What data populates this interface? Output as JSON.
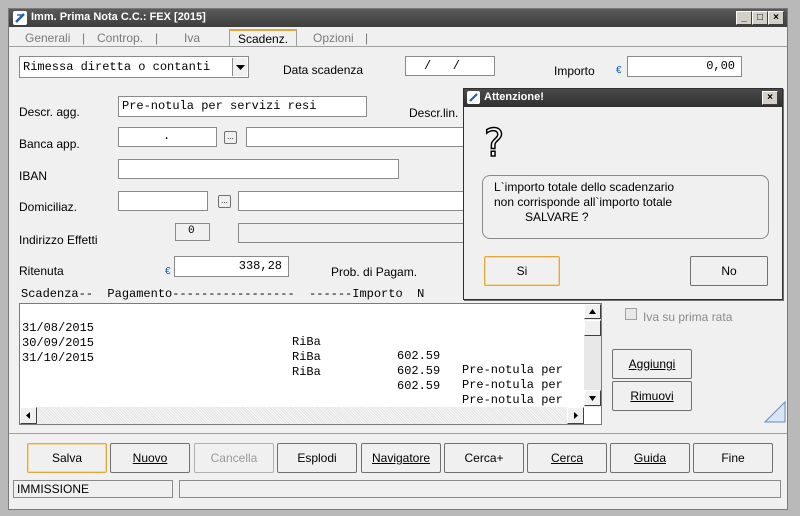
{
  "window": {
    "title": "Imm. Prima Nota C.C.: FEX [2015]",
    "minimize": "_",
    "maximize": "□",
    "close": "×"
  },
  "tabs": [
    {
      "label": "Generali"
    },
    {
      "label": "Controp."
    },
    {
      "label": "Iva"
    },
    {
      "label": "Scadenz.",
      "active": true
    },
    {
      "label": "Opzioni"
    }
  ],
  "tab_separator": "|",
  "form": {
    "payment_type": "Rimessa diretta o contanti",
    "data_scadenza_label": "Data scadenza",
    "data_scadenza_value": "/   /",
    "importo_label": "Importo",
    "currency_symbol": "€",
    "importo_value": "0,00",
    "descr_agg_label": "Descr. agg.",
    "descr_agg_value": "Pre-notula per servizi resi",
    "descr_lin_label": "Descr.lin.",
    "banca_label": "Banca app.",
    "banca_value": ".",
    "iban_label": "IBAN",
    "domiciliaz_label": "Domiciliaz.",
    "indirizzo_label": "Indirizzo Effetti",
    "indirizzo_value": "0",
    "ritenuta_label": "Ritenuta",
    "ritenuta_value": "338,28",
    "prob_label": "Prob. di Pagam.",
    "lookup_button": "..."
  },
  "grid": {
    "header": "Scadenza--  Pagamento-----------------  ------Importo  N",
    "rows": [
      {
        "scadenza": "31/08/2015",
        "pagamento": "RiBa",
        "importo": "602.59",
        "note": "Pre-notula per"
      },
      {
        "scadenza": "30/09/2015",
        "pagamento": "RiBa",
        "importo": "602.59",
        "note": "Pre-notula per"
      },
      {
        "scadenza": "31/10/2015",
        "pagamento": "RiBa",
        "importo": "602.59",
        "note": "Pre-notula per"
      }
    ]
  },
  "side": {
    "iva_checkbox_label": "Iva su prima rata",
    "aggiungi_label": "Aggiungi",
    "rimuovi_label": "Rimuovi"
  },
  "toolbar": {
    "salva": "Salva",
    "nuovo": "Nuovo",
    "cancella": "Cancella",
    "esplodi": "Esplodi",
    "navigatore": "Navigatore",
    "cercaplus": "Cerca+",
    "cerca": "Cerca",
    "guida": "Guida",
    "fine": "Fine"
  },
  "status": {
    "mode": "IMMISSIONE",
    "info": ""
  },
  "dialog": {
    "title": "Attenzione!",
    "close": "×",
    "icon": "?",
    "line1": "L`importo totale dello scadenzario",
    "line2": "non corrisponde all`importo totale",
    "line3": "SALVARE ?",
    "yes": "Si",
    "no": "No"
  },
  "colors": {
    "focus_border": "#e2a73d",
    "title_bar": "#3e3e3e",
    "currency": "#0a5cc4"
  },
  "icons": [
    "app-icon",
    "question-icon",
    "dropdown-arrow-icon",
    "scroll-up-icon",
    "scroll-down-icon",
    "scroll-left-icon",
    "scroll-right-icon",
    "resize-grip-icon"
  ]
}
